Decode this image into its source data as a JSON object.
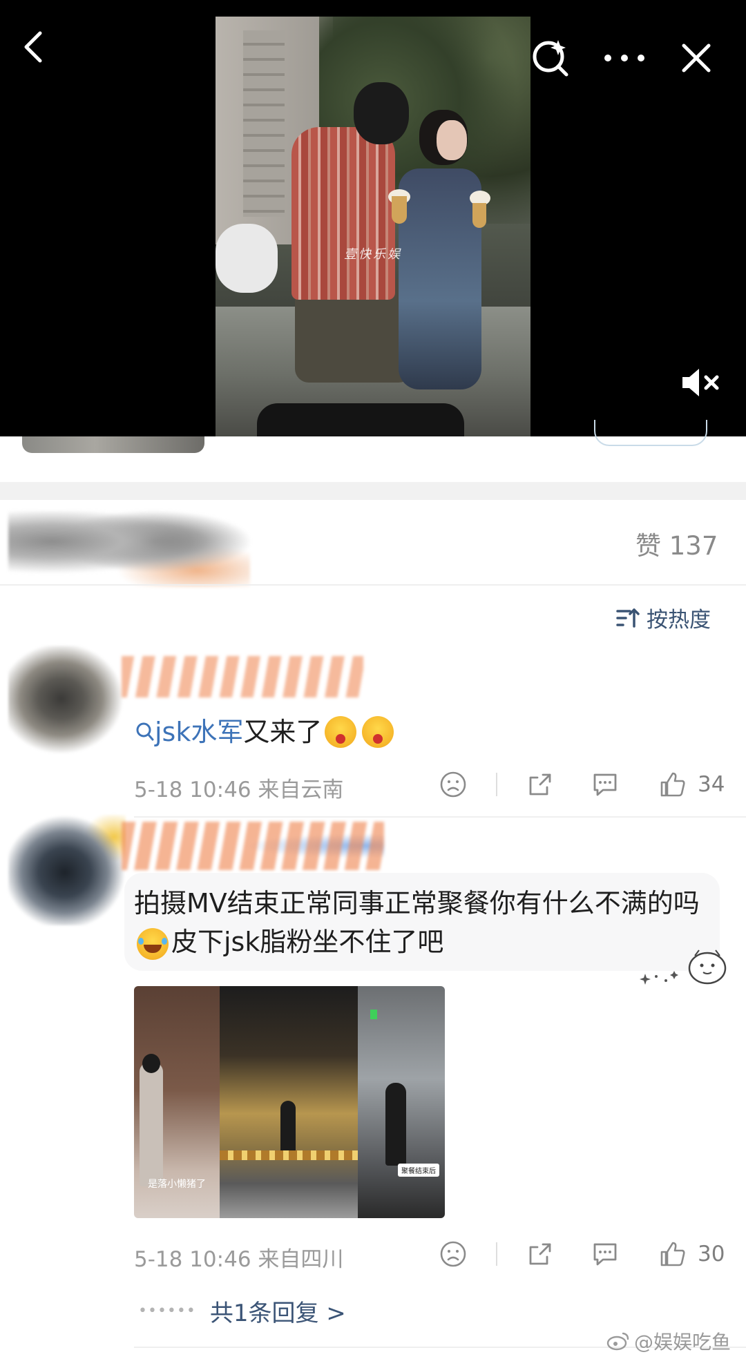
{
  "header": {
    "back_icon": "chevron-left-icon",
    "search_icon": "search-sparkle-icon",
    "more_icon": "more-dots-icon",
    "close_icon": "close-icon",
    "mute_icon": "speaker-muted-icon",
    "video_watermark": "壹快乐娱"
  },
  "likes_header": {
    "label": "赞 137"
  },
  "sort": {
    "label": "按热度",
    "icon": "sort-icon"
  },
  "comments": [
    {
      "link_text": "jsk水军",
      "text_after_link": "又来了",
      "time": "5-18 10:46",
      "location": "来自云南",
      "likes": "34"
    },
    {
      "text_part1": "拍摄MV结束正常同事正常聚餐你有什么不满的吗",
      "text_part2": "皮下jsk脂粉坐不住了吧",
      "time": "5-18 10:46",
      "location": "来自四川",
      "likes": "30",
      "thumbnails": [
        {
          "caption": "是落小懒猪了"
        },
        {
          "caption": ""
        },
        {
          "caption": "聚餐结束后"
        }
      ],
      "reply_label": "共1条回复 >"
    }
  ],
  "footer_watermark": "@娱娱吃鱼",
  "colors": {
    "link_blue": "#3d73b8",
    "sort_blue": "#3a5373",
    "meta_gray": "#9a9a9a"
  }
}
